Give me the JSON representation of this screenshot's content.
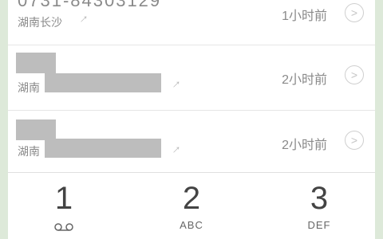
{
  "call_log": {
    "entries": [
      {
        "number": "0731-84303129",
        "location": "湖南长沙",
        "time": "1小时前",
        "redacted": false
      },
      {
        "number": "",
        "location": "湖南",
        "time": "2小时前",
        "redacted": true
      },
      {
        "number": "",
        "location": "湖南",
        "time": "2小时前",
        "redacted": true
      }
    ],
    "info_glyph": ">",
    "outgoing_arrow_glyph": "→"
  },
  "dialpad": {
    "keys": [
      {
        "digit": "1",
        "letters": "",
        "icon": "voicemail-icon"
      },
      {
        "digit": "2",
        "letters": "ABC"
      },
      {
        "digit": "3",
        "letters": "DEF"
      }
    ]
  },
  "colors": {
    "background": "#dde9d9",
    "text": "#8a8a8a",
    "redaction": "#bdbdbd"
  }
}
